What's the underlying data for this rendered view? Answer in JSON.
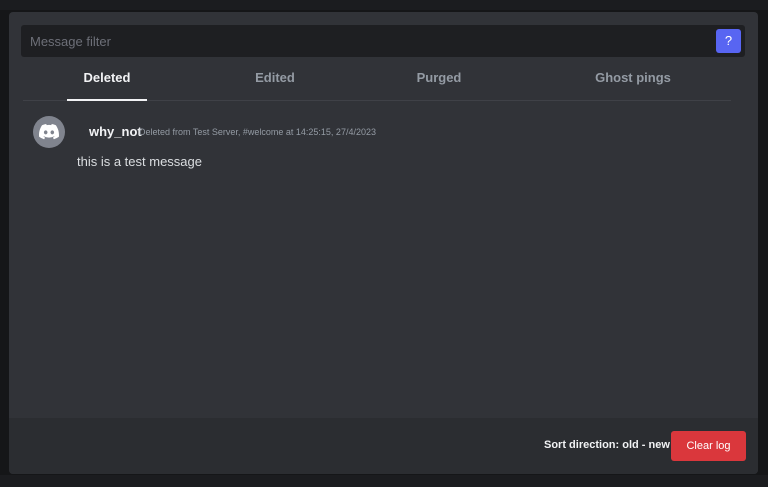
{
  "filter": {
    "placeholder": "Message filter",
    "value": "",
    "help_label": "?"
  },
  "tabs": [
    {
      "label": "Deleted",
      "active": true
    },
    {
      "label": "Edited",
      "active": false
    },
    {
      "label": "Purged",
      "active": false
    },
    {
      "label": "Ghost pings",
      "active": false
    }
  ],
  "messages": [
    {
      "avatar_icon": "discord-logo-icon",
      "username": "why_not",
      "meta": "Deleted from Test Server, #welcome at 14:25:15, 27/4/2023",
      "content": "this is a test message"
    }
  ],
  "footer": {
    "sort_label": "Sort direction: old - new",
    "clear_label": "Clear log"
  },
  "colors": {
    "modal_bg": "#313338",
    "accent": "#5865f2",
    "danger": "#da373c",
    "footer_bg": "#2b2d31"
  }
}
